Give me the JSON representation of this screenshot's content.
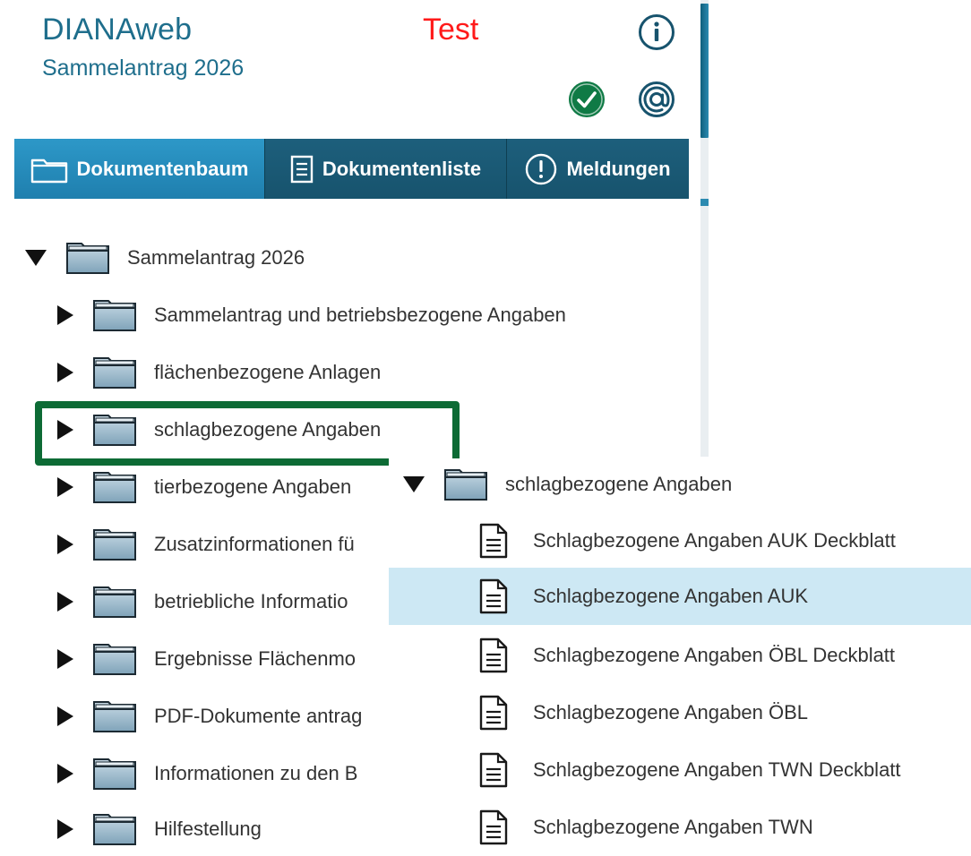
{
  "header": {
    "app_title": "DIANAweb",
    "subtitle": "Sammelantrag 2026",
    "environment": "Test",
    "environment_color": "#ff1a1a",
    "brand_color": "#1e6e8c"
  },
  "icons": {
    "info": "info-circle-icon",
    "status": "check-circle-icon",
    "mail": "at-sign-icon",
    "folder": "folder-icon",
    "document": "document-icon"
  },
  "tabs": [
    {
      "label": "Dokumentenbaum",
      "icon": "folder-icon",
      "active": true
    },
    {
      "label": "Dokumentenliste",
      "icon": "list-document-icon",
      "active": false
    },
    {
      "label": "Meldungen",
      "icon": "exclamation-circle-icon",
      "active": false
    }
  ],
  "tree": {
    "root": {
      "label": "Sammelantrag 2026",
      "expanded": true
    },
    "children": [
      {
        "label": "Sammelantrag und betriebsbezogene Angaben",
        "expanded": false
      },
      {
        "label": "flächenbezogene Anlagen",
        "expanded": false
      },
      {
        "label": "schlagbezogene Angaben",
        "expanded": false,
        "highlighted": true
      },
      {
        "label": "tierbezogene Angaben",
        "expanded": false
      },
      {
        "label": "Zusatzinformationen fü",
        "expanded": false
      },
      {
        "label": "betriebliche Informatio",
        "expanded": false
      },
      {
        "label": "Ergebnisse Flächenmo",
        "expanded": false
      },
      {
        "label": "PDF-Dokumente antrag",
        "expanded": false
      },
      {
        "label": "Informationen zu den B",
        "expanded": false
      },
      {
        "label": "Hilfestellung",
        "expanded": false
      }
    ]
  },
  "expanded_node": {
    "label": "schlagbezogene Angaben",
    "documents": [
      {
        "label": "Schlagbezogene Angaben AUK Deckblatt",
        "selected": false
      },
      {
        "label": "Schlagbezogene Angaben AUK",
        "selected": true
      },
      {
        "label": "Schlagbezogene Angaben ÖBL Deckblatt",
        "selected": false
      },
      {
        "label": "Schlagbezogene Angaben ÖBL",
        "selected": false
      },
      {
        "label": "Schlagbezogene Angaben TWN Deckblatt",
        "selected": false
      },
      {
        "label": "Schlagbezogene Angaben TWN",
        "selected": false
      }
    ]
  },
  "colors": {
    "tab_bar": "#17536d",
    "tab_active": "#2d98c8",
    "highlight_frame": "#0d6b35",
    "selected_row": "#cde8f4",
    "status_ok": "#0f7a45"
  }
}
